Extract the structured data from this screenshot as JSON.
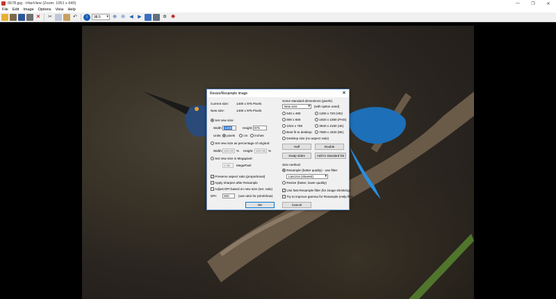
{
  "window": {
    "title": "0678.jpg - IrfanView (Zoom: 1051 x 640)",
    "controls": [
      "—",
      "❐",
      "✕"
    ]
  },
  "menu": [
    "File",
    "Edit",
    "Image",
    "Options",
    "View",
    "Help"
  ],
  "toolbar": {
    "zoom_value": "98.5"
  },
  "dialog": {
    "title": "Resize/Resample image",
    "current_size_label": "Current size:",
    "current_size_value": "1400  x  975  Pixels",
    "new_size_label": "New size:",
    "new_size_value": "1400  x  975  Pixels",
    "set_new_size_label": "Set new size:",
    "width_label": "Width:",
    "width_value": "1400",
    "height_label": "Height:",
    "height_value": "975",
    "units_label": "Units:",
    "units": [
      "pixels",
      "cm",
      "inches"
    ],
    "percentage_label": "Set new size as percentage of original:",
    "pct_width_label": "Width:",
    "pct_width_value": "100.00",
    "pct_height_label": "Height:",
    "pct_height_value": "100.00",
    "pct_symbol": "%",
    "megapixel_label": "Set new size in Megapixel:",
    "megapixel_value": "1.36",
    "megapixel_unit": "MegaPixel",
    "preserve_label": "Preserve aspect ratio (proportional)",
    "sharpen_label": "Apply sharpen after Resample",
    "adjust_dpi_label": "Adjust DPI based on new size (set. ratio)",
    "dpi_label": "DPI:",
    "dpi_value": "300",
    "dpi_note": "(use ratio for print/show)",
    "standard_title": "Some standard dimensions (pixels):",
    "standard_select": "New size:",
    "standard_hint": "(with option used)",
    "standard_options": [
      [
        "640 x 480",
        "1280 x 720 (HD)"
      ],
      [
        "800 x 600",
        "1920 x 1080 (FHD)"
      ],
      [
        "1024 x 768",
        "3840 x 2160 (4K)"
      ],
      [
        "Best fit to desktop",
        "7680 x 4320 (8K)"
      ],
      [
        "Desktop size (no aspect ratio)",
        ""
      ]
    ],
    "half_button": "Half",
    "double_button": "Double",
    "swap_button": "Swap sides",
    "add_button": "Add to standard list",
    "method_title": "Size method:",
    "resample_label": "Resample (better quality) - use filter:",
    "filter_value": "Lanczos (slowest)",
    "resize_label": "Resize (faster, lower quality)",
    "fast_resample_label": "Use fast Resample filter (for image shrinking)",
    "gamma_label": "Try to improve gamma for Resample (Help file)",
    "ok_button": "OK",
    "cancel_button": "Cancel"
  }
}
